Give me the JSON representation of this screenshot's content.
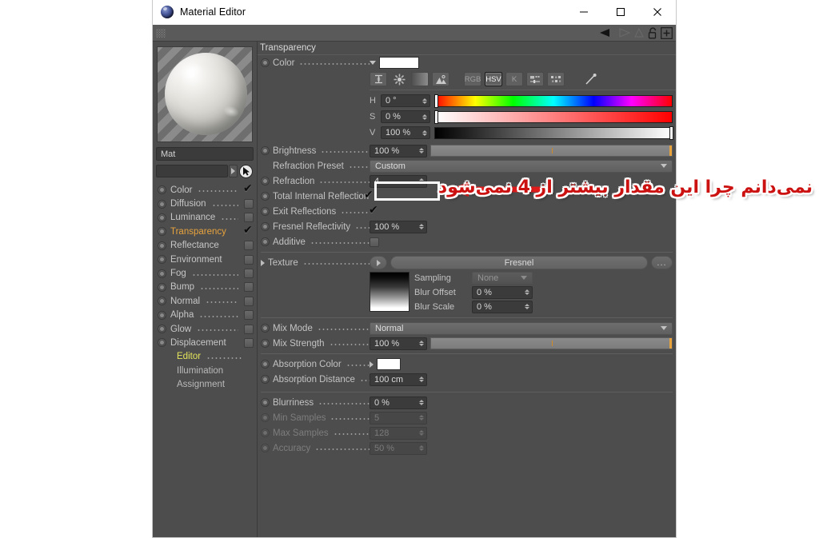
{
  "window": {
    "title": "Material Editor",
    "app_icon": "cinema4d-sphere-icon",
    "minimize_label": "−",
    "maximize_label": "▢",
    "close_label": "✕"
  },
  "toolbar": {
    "grip": "drag-grip",
    "icons": [
      "back-arrow-icon",
      "forward-arrow-icon",
      "up-arrow-icon",
      "lock-icon",
      "add-icon"
    ]
  },
  "sidebar": {
    "material_name": "Mat",
    "search_value": "",
    "channels": [
      {
        "label": "Color",
        "checked": true,
        "dots": true,
        "active": false
      },
      {
        "label": "Diffusion",
        "checked": false,
        "dots": true,
        "active": false
      },
      {
        "label": "Luminance",
        "checked": false,
        "dots": true,
        "active": false
      },
      {
        "label": "Transparency",
        "checked": true,
        "dots": false,
        "active": true
      },
      {
        "label": "Reflectance",
        "checked": false,
        "dots": false,
        "active": false
      },
      {
        "label": "Environment",
        "checked": false,
        "dots": false,
        "active": false
      },
      {
        "label": "Fog",
        "checked": false,
        "dots": true,
        "active": false
      },
      {
        "label": "Bump",
        "checked": false,
        "dots": true,
        "active": false
      },
      {
        "label": "Normal",
        "checked": false,
        "dots": true,
        "active": false
      },
      {
        "label": "Alpha",
        "checked": false,
        "dots": true,
        "active": false
      },
      {
        "label": "Glow",
        "checked": false,
        "dots": true,
        "active": false
      },
      {
        "label": "Displacement",
        "checked": false,
        "dots": false,
        "active": false
      }
    ],
    "sub_items": [
      {
        "label": "Editor",
        "highlight": true
      },
      {
        "label": "Illumination",
        "highlight": false
      },
      {
        "label": "Assignment",
        "highlight": false
      }
    ]
  },
  "main": {
    "section_title": "Transparency",
    "color": {
      "label": "Color",
      "swatch": "#ffffff",
      "mode_buttons": [
        {
          "name": "range-icon",
          "label": ""
        },
        {
          "name": "color-wheel-icon",
          "label": ""
        },
        {
          "name": "gradient-icon",
          "label": ""
        },
        {
          "name": "image-picker-icon",
          "label": ""
        },
        {
          "name": "rgb-mode",
          "label": "RGB",
          "selected": false
        },
        {
          "name": "hsv-mode",
          "label": "HSV",
          "selected": true
        },
        {
          "name": "kelvin-mode",
          "label": "K",
          "selected": false
        },
        {
          "name": "sliders-icon",
          "label": ""
        },
        {
          "name": "swatches-icon",
          "label": ""
        },
        {
          "name": "eyedropper-icon",
          "label": ""
        }
      ],
      "channels": [
        {
          "tag": "H",
          "value": "0 °",
          "knob_pct": 0
        },
        {
          "tag": "S",
          "value": "0 %",
          "knob_pct": 0
        },
        {
          "tag": "V",
          "value": "100 %",
          "knob_pct": 100
        }
      ]
    },
    "rows": [
      {
        "label": "Brightness",
        "value": "100 %"
      },
      {
        "label": "Refraction Preset",
        "value": "Custom"
      },
      {
        "label": "Refraction",
        "value": "4"
      },
      {
        "label": "Total Internal Reflection",
        "value": ""
      },
      {
        "label": "Exit Reflections",
        "value": ""
      },
      {
        "label": "Fresnel Reflectivity",
        "value": "100 %"
      },
      {
        "label": "Additive",
        "value": ""
      }
    ],
    "texture": {
      "label": "Texture",
      "name": "Fresnel",
      "browse_label": "...",
      "sampling_label": "Sampling",
      "sampling_value": "None",
      "blur_offset_label": "Blur Offset",
      "blur_offset_value": "0 %",
      "blur_scale_label": "Blur Scale",
      "blur_scale_value": "0 %"
    },
    "mix": {
      "mode_label": "Mix Mode",
      "mode_value": "Normal",
      "strength_label": "Mix Strength",
      "strength_value": "100 %"
    },
    "absorption": {
      "color_label": "Absorption Color",
      "color_swatch": "#ffffff",
      "distance_label": "Absorption Distance",
      "distance_value": "100 cm"
    },
    "blur": [
      {
        "label": "Blurriness",
        "value": "0 %",
        "disabled": false
      },
      {
        "label": "Min Samples",
        "value": "5",
        "disabled": true
      },
      {
        "label": "Max Samples",
        "value": "128",
        "disabled": true
      },
      {
        "label": "Accuracy",
        "value": "50 %",
        "disabled": true
      }
    ]
  },
  "annotation": {
    "text": "نمی‌دانم چرا این مقدار بیشتر از 4 نمی‌شود",
    "color": "#cc1111",
    "outline_color": "#ffffff",
    "arrow": "left-arrow-annotation",
    "highlight_target": "refraction-field"
  }
}
